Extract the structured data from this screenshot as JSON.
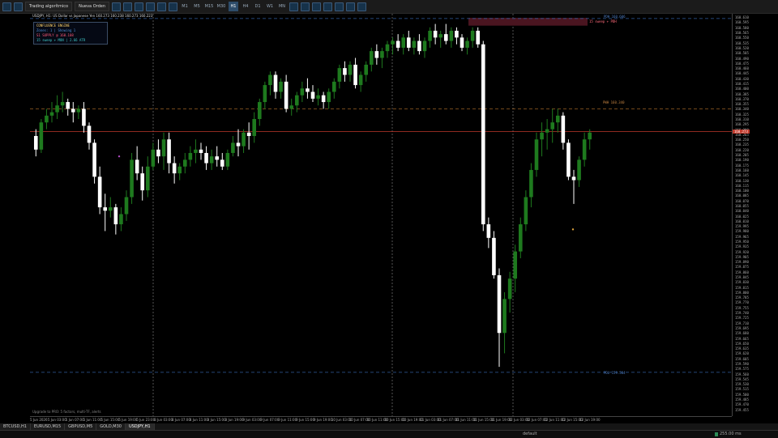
{
  "toolbar": {
    "algo_label": "Trading algorítmico",
    "new_order_label": "Nueva Orden",
    "timeframes": [
      "M1",
      "M5",
      "M15",
      "M30",
      "H1",
      "H4",
      "D1",
      "W1",
      "MN"
    ],
    "active_timeframe": "H1",
    "icons": [
      "chart-icon",
      "refresh-icon",
      "grid-icon",
      "bars-icon",
      "candles-icon",
      "line-icon",
      "zoom-in-icon",
      "zoom-out-icon",
      "crosshair-icon",
      "vertical-line-icon",
      "horizontal-line-icon",
      "trendline-icon",
      "text-icon",
      "fibo-icon",
      "shapes-icon"
    ]
  },
  "chart": {
    "title": "USDJPY, H1:  US Dollar vs Japanese Yen  160.273 160.238 160.273 160.223",
    "panel": {
      "title": "CONFLUENCE ENGINE",
      "zones": "Zones: 1 | Showing 1",
      "supply": "S1 SUPPLY @ 160.108",
      "info": "15 sweep + MON | 2.66 ATR"
    },
    "footer_note": "Upgrade to PRO: 5 factors, multi-TF, alerts",
    "levels": {
      "pdh": "PDH 160.606",
      "pwh": "PWH 160.340",
      "pdl": "PDL 159.564",
      "zone_label": "15 sweep + PDH",
      "current_price": "160.273"
    },
    "colors": {
      "bull": "#1e7a1e",
      "bear": "#ffffff",
      "pdh": "#2f5c9e",
      "pwh": "#b8742a",
      "pdl": "#2f5c9e",
      "price_line": "#c0392b",
      "supply_zone": "#4a1520",
      "grid": "#8a8a8a"
    }
  },
  "chart_data": {
    "type": "candlestick",
    "symbol": "USDJPY",
    "timeframe": "H1",
    "ylim": [
      159.435,
      160.62
    ],
    "y_ticks": [
      "160.610",
      "160.595",
      "160.580",
      "160.565",
      "160.550",
      "160.535",
      "160.520",
      "160.505",
      "160.490",
      "160.475",
      "160.460",
      "160.445",
      "160.430",
      "160.415",
      "160.400",
      "160.385",
      "160.370",
      "160.355",
      "160.340",
      "160.325",
      "160.310",
      "160.295",
      "160.280",
      "160.265",
      "160.250",
      "160.235",
      "160.220",
      "160.205",
      "160.190",
      "160.175",
      "160.160",
      "160.145",
      "160.130",
      "160.115",
      "160.100",
      "160.085",
      "160.070",
      "160.055",
      "160.040",
      "160.025",
      "160.010",
      "159.995",
      "159.980",
      "159.965",
      "159.950",
      "159.935",
      "159.920",
      "159.905",
      "159.890",
      "159.875",
      "159.860",
      "159.845",
      "159.830",
      "159.815",
      "159.800",
      "159.785",
      "159.770",
      "159.755",
      "159.740",
      "159.725",
      "159.710",
      "159.695",
      "159.680",
      "159.665",
      "159.650",
      "159.635",
      "159.620",
      "159.605",
      "159.590",
      "159.575",
      "159.560",
      "159.545",
      "159.530",
      "159.515",
      "159.500",
      "159.485",
      "159.470",
      "159.455",
      "159.440"
    ],
    "x_ticks": [
      "5 Jun 2026",
      "5 Jun 03:00",
      "5 Jun 07:00",
      "5 Jun 11:00",
      "5 Jun 15:00",
      "5 Jun 19:00",
      "5 Jun 23:00",
      "8 Jun 03:00",
      "8 Jun 07:00",
      "8 Jun 11:00",
      "8 Jun 15:00",
      "8 Jun 19:00",
      "9 Jun 03:00",
      "9 Jun 07:00",
      "9 Jun 11:00",
      "9 Jun 15:00",
      "9 Jun 19:00",
      "10 Jun 03:00",
      "10 Jun 07:00",
      "10 Jun 11:00",
      "10 Jun 15:00",
      "10 Jun 19:00",
      "11 Jun 03:00",
      "11 Jun 07:00",
      "11 Jun 11:00",
      "11 Jun 15:00",
      "11 Jun 19:00",
      "12 Jun 03:00",
      "12 Jun 07:00",
      "12 Jun 11:00",
      "12 Jun 15:00",
      "12 Jun 19:00"
    ],
    "candles": [
      [
        160.26,
        160.28,
        160.2,
        160.22
      ],
      [
        160.22,
        160.31,
        160.21,
        160.3
      ],
      [
        160.3,
        160.34,
        160.28,
        160.32
      ],
      [
        160.32,
        160.36,
        160.3,
        160.33
      ],
      [
        160.33,
        160.38,
        160.31,
        160.35
      ],
      [
        160.35,
        160.39,
        160.33,
        160.36
      ],
      [
        160.36,
        160.37,
        160.32,
        160.34
      ],
      [
        160.34,
        160.36,
        160.3,
        160.33
      ],
      [
        160.33,
        160.35,
        160.31,
        160.34
      ],
      [
        160.34,
        160.36,
        160.27,
        160.29
      ],
      [
        160.29,
        160.3,
        160.22,
        160.24
      ],
      [
        160.24,
        160.25,
        160.12,
        160.14
      ],
      [
        160.14,
        160.17,
        160.03,
        160.05
      ],
      [
        160.05,
        160.09,
        159.98,
        160.04
      ],
      [
        160.04,
        160.08,
        160.02,
        160.05
      ],
      [
        160.05,
        160.06,
        159.97,
        160.0
      ],
      [
        160.0,
        160.05,
        159.98,
        160.03
      ],
      [
        160.03,
        160.1,
        160.01,
        160.08
      ],
      [
        160.08,
        160.21,
        160.06,
        160.19
      ],
      [
        160.19,
        160.23,
        160.13,
        160.15
      ],
      [
        160.15,
        160.17,
        160.07,
        160.1
      ],
      [
        160.1,
        160.2,
        160.08,
        160.17
      ],
      [
        160.17,
        160.24,
        160.16,
        160.22
      ],
      [
        160.22,
        160.25,
        160.18,
        160.2
      ],
      [
        160.2,
        160.27,
        160.16,
        160.25
      ],
      [
        160.25,
        160.27,
        160.15,
        160.18
      ],
      [
        160.18,
        160.2,
        160.12,
        160.15
      ],
      [
        160.15,
        160.18,
        160.13,
        160.17
      ],
      [
        160.17,
        160.21,
        160.15,
        160.19
      ],
      [
        160.19,
        160.23,
        160.17,
        160.21
      ],
      [
        160.21,
        160.25,
        160.18,
        160.22
      ],
      [
        160.22,
        160.24,
        160.19,
        160.21
      ],
      [
        160.21,
        160.23,
        160.16,
        160.18
      ],
      [
        160.18,
        160.22,
        160.16,
        160.2
      ],
      [
        160.2,
        160.23,
        160.17,
        160.19
      ],
      [
        160.19,
        160.21,
        160.16,
        160.17
      ],
      [
        160.17,
        160.22,
        160.16,
        160.21
      ],
      [
        160.21,
        160.26,
        160.2,
        160.24
      ],
      [
        160.24,
        160.28,
        160.2,
        160.23
      ],
      [
        160.23,
        160.28,
        160.21,
        160.27
      ],
      [
        160.27,
        160.3,
        160.22,
        160.26
      ],
      [
        160.26,
        160.33,
        160.24,
        160.31
      ],
      [
        160.31,
        160.37,
        160.29,
        160.36
      ],
      [
        160.36,
        160.42,
        160.34,
        160.41
      ],
      [
        160.41,
        160.45,
        160.38,
        160.44
      ],
      [
        160.44,
        160.45,
        160.37,
        160.39
      ],
      [
        160.39,
        160.43,
        160.37,
        160.42
      ],
      [
        160.42,
        160.44,
        160.33,
        160.34
      ],
      [
        160.34,
        160.37,
        160.32,
        160.35
      ],
      [
        160.35,
        160.39,
        160.33,
        160.38
      ],
      [
        160.38,
        160.42,
        160.36,
        160.4
      ],
      [
        160.4,
        160.43,
        160.37,
        160.39
      ],
      [
        160.39,
        160.41,
        160.36,
        160.37
      ],
      [
        160.37,
        160.4,
        160.35,
        160.38
      ],
      [
        160.38,
        160.39,
        160.34,
        160.36
      ],
      [
        160.36,
        160.4,
        160.34,
        160.39
      ],
      [
        160.39,
        160.43,
        160.37,
        160.42
      ],
      [
        160.42,
        160.47,
        160.4,
        160.46
      ],
      [
        160.46,
        160.48,
        160.42,
        160.44
      ],
      [
        160.44,
        160.48,
        160.42,
        160.47
      ],
      [
        160.47,
        160.49,
        160.4,
        160.41
      ],
      [
        160.41,
        160.45,
        160.39,
        160.44
      ],
      [
        160.44,
        160.48,
        160.42,
        160.47
      ],
      [
        160.47,
        160.52,
        160.45,
        160.51
      ],
      [
        160.51,
        160.53,
        160.47,
        160.49
      ],
      [
        160.49,
        160.52,
        160.46,
        160.51
      ],
      [
        160.51,
        160.54,
        160.49,
        160.53
      ],
      [
        160.53,
        160.55,
        160.5,
        160.54
      ],
      [
        160.54,
        160.56,
        160.51,
        160.52
      ],
      [
        160.52,
        160.56,
        160.5,
        160.55
      ],
      [
        160.55,
        160.57,
        160.51,
        160.52
      ],
      [
        160.52,
        160.55,
        160.5,
        160.54
      ],
      [
        160.54,
        160.56,
        160.5,
        160.51
      ],
      [
        160.51,
        160.55,
        160.49,
        160.54
      ],
      [
        160.54,
        160.58,
        160.52,
        160.57
      ],
      [
        160.57,
        160.59,
        160.53,
        160.55
      ],
      [
        160.55,
        160.57,
        160.52,
        160.56
      ],
      [
        160.56,
        160.59,
        160.53,
        160.54
      ],
      [
        160.54,
        160.58,
        160.52,
        160.57
      ],
      [
        160.57,
        160.58,
        160.53,
        160.55
      ],
      [
        160.55,
        160.56,
        160.51,
        160.52
      ],
      [
        160.52,
        160.55,
        160.5,
        160.54
      ],
      [
        160.54,
        160.58,
        160.52,
        160.57
      ],
      [
        160.57,
        160.58,
        160.52,
        160.53
      ],
      [
        160.53,
        160.54,
        159.98,
        160.0
      ],
      [
        160.0,
        160.02,
        159.93,
        159.96
      ],
      [
        159.96,
        159.98,
        159.84,
        159.85
      ],
      [
        159.85,
        159.87,
        159.58,
        159.68
      ],
      [
        159.68,
        159.8,
        159.62,
        159.78
      ],
      [
        159.78,
        159.86,
        159.74,
        159.84
      ],
      [
        159.84,
        159.94,
        159.8,
        159.92
      ],
      [
        159.92,
        160.02,
        159.9,
        160.0
      ],
      [
        160.0,
        160.1,
        159.98,
        160.08
      ],
      [
        160.08,
        160.18,
        160.05,
        160.16
      ],
      [
        160.16,
        160.27,
        160.14,
        160.25
      ],
      [
        160.25,
        160.3,
        160.2,
        160.27
      ],
      [
        160.27,
        160.31,
        160.22,
        160.28
      ],
      [
        160.28,
        160.34,
        160.24,
        160.3
      ],
      [
        160.3,
        160.34,
        160.27,
        160.32
      ],
      [
        160.32,
        160.33,
        160.22,
        160.24
      ],
      [
        160.24,
        160.25,
        160.13,
        160.14
      ],
      [
        160.14,
        160.16,
        160.06,
        160.13
      ],
      [
        160.13,
        160.2,
        160.11,
        160.19
      ],
      [
        160.19,
        160.27,
        160.17,
        160.25
      ],
      [
        160.25,
        160.28,
        160.22,
        160.27
      ]
    ]
  }
}
